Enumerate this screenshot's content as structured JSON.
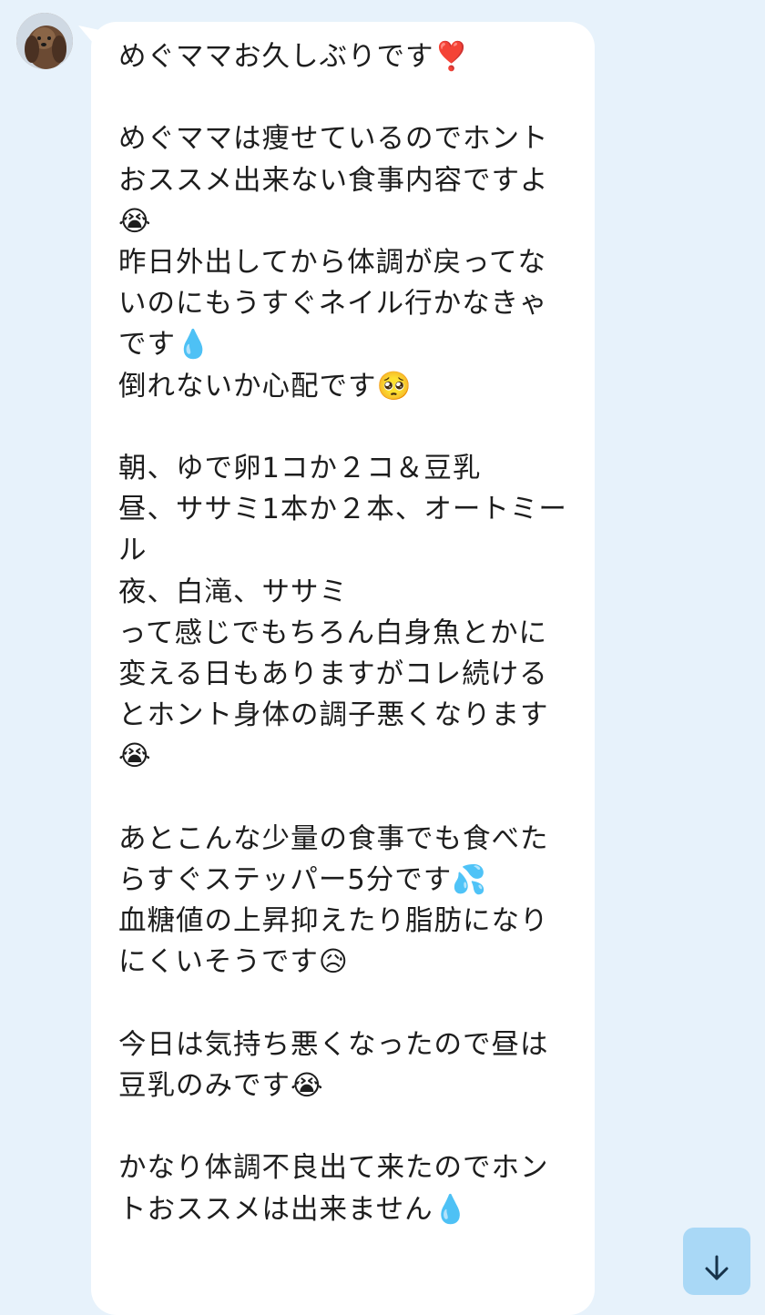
{
  "chat": {
    "sender_avatar": {
      "icon": "dog-avatar-icon"
    },
    "message_text": "めぐママお久しぶりです❣️\n\nめぐママは痩せているのでホントおススメ出来ない食事内容ですよ😭\n昨日外出してから体調が戻ってないのにもうすぐネイル行かなきゃです💧\n倒れないか心配です🥺\n\n朝、ゆで卵1コか２コ＆豆乳\n昼、ササミ1本か２本、オートミール\n夜、白滝、ササミ\nって感じでもちろん白身魚とかに変える日もありますがコレ続けるとホント身体の調子悪くなります😭\n\nあとこんな少量の食事でも食べたらすぐステッパー5分です💦\n血糖値の上昇抑えたり脂肪になりにくいそうです😥\n\n今日は気持ち悪くなったので昼は豆乳のみです😭\n\nかなり体調不良出て来たのでホントおススメは出来ません💧"
  },
  "scroll_to_bottom": {
    "icon": "arrow-down-icon"
  },
  "colors": {
    "background": "#e7f2fb",
    "bubble": "#ffffff",
    "text": "#1d1d1d",
    "scroll_button": "#a9d8f6"
  }
}
